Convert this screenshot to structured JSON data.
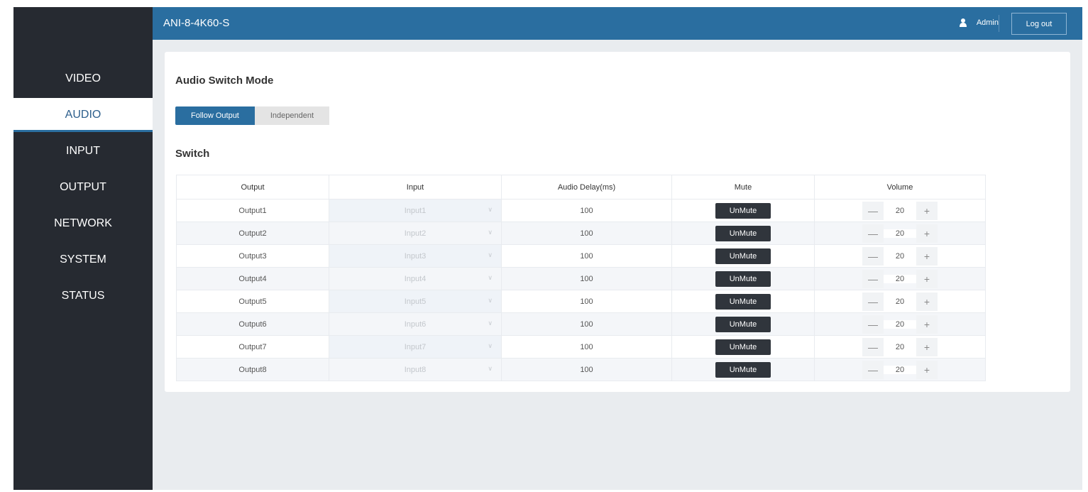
{
  "sidebar": {
    "items": [
      {
        "label": "VIDEO",
        "active": false
      },
      {
        "label": "AUDIO",
        "active": true
      },
      {
        "label": "INPUT",
        "active": false
      },
      {
        "label": "OUTPUT",
        "active": false
      },
      {
        "label": "NETWORK",
        "active": false
      },
      {
        "label": "SYSTEM",
        "active": false
      },
      {
        "label": "STATUS",
        "active": false
      }
    ]
  },
  "header": {
    "title": "ANI-8-4K60-S",
    "user": "Admin",
    "logout": "Log out",
    "user_icon": "user-icon"
  },
  "mode": {
    "heading": "Audio Switch Mode",
    "options": [
      "Follow Output",
      "Independent"
    ],
    "selected": "Follow Output"
  },
  "switch": {
    "heading": "Switch",
    "columns": [
      "Output",
      "Input",
      "Audio Delay(ms)",
      "Mute",
      "Volume"
    ],
    "rows": [
      {
        "output": "Output1",
        "input": "Input1",
        "delay": "100",
        "mute": "UnMute",
        "volume": "20"
      },
      {
        "output": "Output2",
        "input": "Input2",
        "delay": "100",
        "mute": "UnMute",
        "volume": "20"
      },
      {
        "output": "Output3",
        "input": "Input3",
        "delay": "100",
        "mute": "UnMute",
        "volume": "20"
      },
      {
        "output": "Output4",
        "input": "Input4",
        "delay": "100",
        "mute": "UnMute",
        "volume": "20"
      },
      {
        "output": "Output5",
        "input": "Input5",
        "delay": "100",
        "mute": "UnMute",
        "volume": "20"
      },
      {
        "output": "Output6",
        "input": "Input6",
        "delay": "100",
        "mute": "UnMute",
        "volume": "20"
      },
      {
        "output": "Output7",
        "input": "Input7",
        "delay": "100",
        "mute": "UnMute",
        "volume": "20"
      },
      {
        "output": "Output8",
        "input": "Input8",
        "delay": "100",
        "mute": "UnMute",
        "volume": "20"
      }
    ]
  },
  "colors": {
    "accent": "#2a6ea0",
    "sidebar": "#262a31",
    "background": "#e9ecef"
  }
}
